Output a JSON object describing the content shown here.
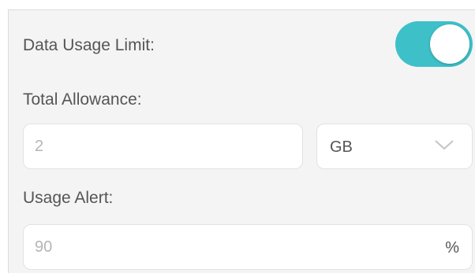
{
  "data_usage_limit": {
    "label": "Data Usage Limit:",
    "enabled": true
  },
  "total_allowance": {
    "label": "Total Allowance:",
    "value": "2",
    "unit": "GB"
  },
  "usage_alert": {
    "label": "Usage Alert:",
    "value": "90",
    "unit": "%"
  },
  "colors": {
    "toggle_on": "#3ec0c9",
    "panel_bg": "#f4f4f4",
    "label_text": "#555555",
    "placeholder_text": "#b5b5b5"
  }
}
